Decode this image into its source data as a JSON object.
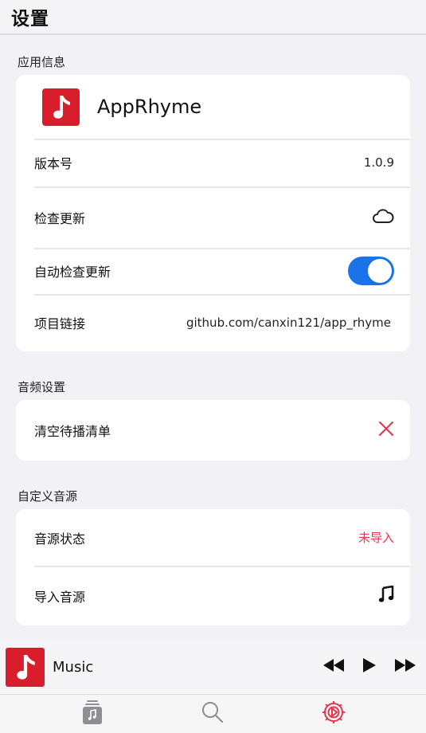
{
  "header": {
    "title": "设置"
  },
  "sections": {
    "app_info": {
      "label": "应用信息",
      "app_name": "AppRhyme",
      "version_label": "版本号",
      "version_value": "1.0.9",
      "check_update_label": "检查更新",
      "auto_check_label": "自动检查更新",
      "auto_check_enabled": true,
      "project_link_label": "项目链接",
      "project_link_value": "github.com/canxin121/app_rhyme"
    },
    "audio": {
      "label": "音频设置",
      "clear_queue_label": "清空待播清单"
    },
    "custom_source": {
      "label": "自定义音源",
      "status_label": "音源状态",
      "status_value": "未导入",
      "import_label": "导入音源"
    }
  },
  "player": {
    "title": "Music"
  },
  "tabs": [
    {
      "icon": "library-icon",
      "active": false
    },
    {
      "icon": "search-icon",
      "active": false
    },
    {
      "icon": "settings-icon",
      "active": true
    }
  ],
  "colors": {
    "accent_red": "#e8334a",
    "toggle_blue": "#1a73e8",
    "brand_red": "#d81e2c"
  }
}
